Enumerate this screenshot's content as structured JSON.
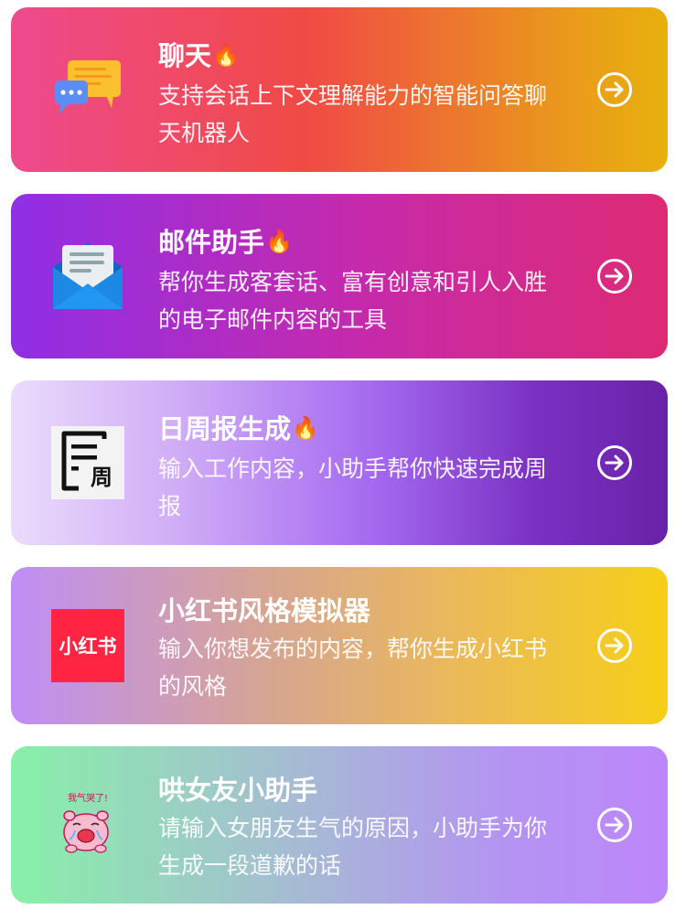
{
  "cards": [
    {
      "title": "聊天",
      "fire": "🔥",
      "desc": "支持会话上下文理解能力的智能问答聊天机器人",
      "icon": "chat-bubbles-icon"
    },
    {
      "title": "邮件助手",
      "fire": "🔥",
      "desc": "帮你生成客套话、富有创意和引人入胜的电子邮件内容的工具",
      "icon": "envelope-icon"
    },
    {
      "title": "日周报生成",
      "fire": "🔥",
      "desc": "输入工作内容，小助手帮你快速完成周报",
      "icon": "weekly-report-icon",
      "icon_text": "周"
    },
    {
      "title": "小红书风格模拟器",
      "desc": "输入你想发布的内容，帮你生成小红书的风格",
      "icon": "xiaohongshu-logo",
      "icon_text": "小红书"
    },
    {
      "title": "哄女友小助手",
      "desc": "请输入女朋友生气的原因，小助手为你生成一段道歉的话",
      "icon": "crying-pig-sticker-icon",
      "icon_text": "我气哭了!"
    }
  ],
  "colors": {
    "xiaohongshu_red": "#ff2442",
    "envelope_blue": "#1e88e5"
  }
}
